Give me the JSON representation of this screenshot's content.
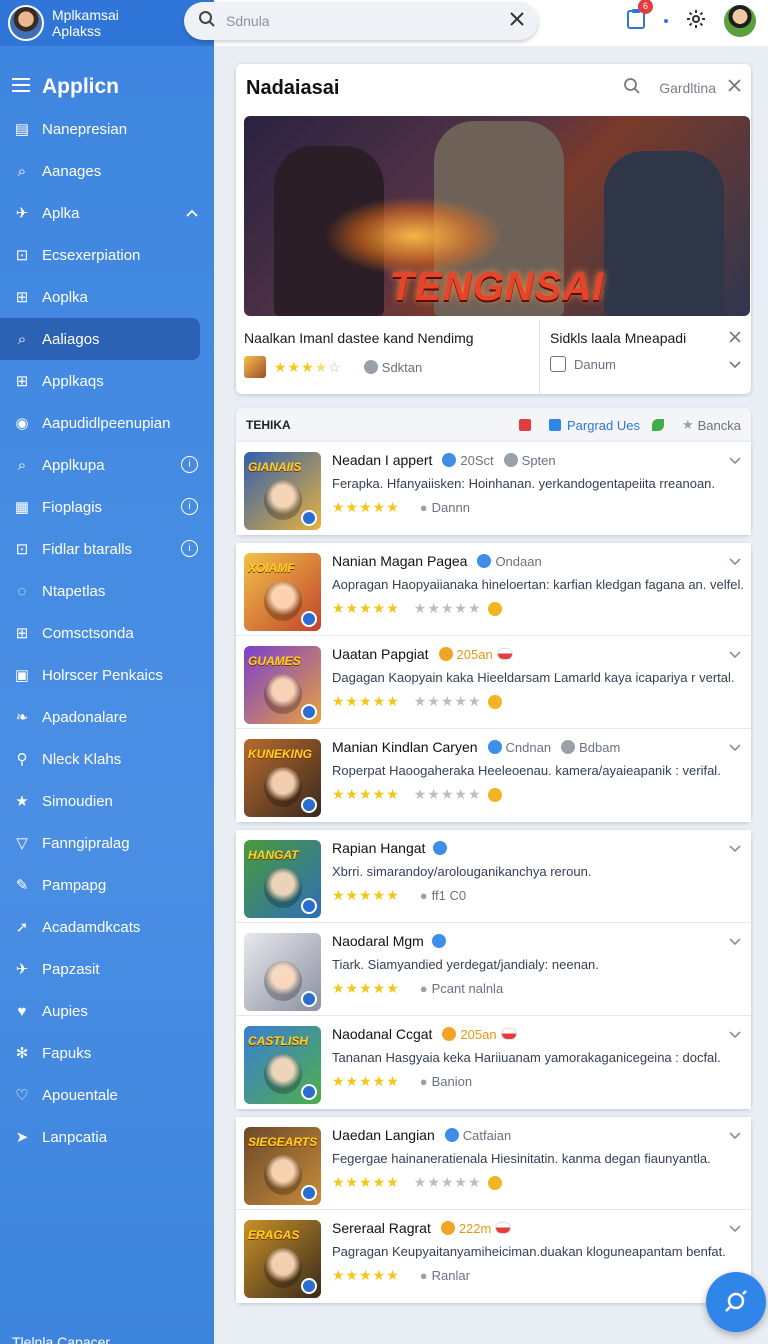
{
  "brand": {
    "line1": "Mplkamsai",
    "line2": "Aplakss"
  },
  "search": {
    "placeholder": "Sdnula"
  },
  "notifications": {
    "badge": "6"
  },
  "sidebar": {
    "header": "Applicn",
    "items": [
      {
        "label": "Nanepresian",
        "icon": "document-icon"
      },
      {
        "label": "Aanages",
        "icon": "search-icon"
      },
      {
        "label": "Aplka",
        "icon": "pin-icon",
        "right": "chevron-up"
      },
      {
        "label": "Ecsexerpiation",
        "icon": "image-icon"
      },
      {
        "label": "Aoplka",
        "icon": "grid-icon"
      },
      {
        "label": "Aaliagos",
        "icon": "search-icon",
        "active": true
      },
      {
        "label": "Applkaqs",
        "icon": "grid-icon"
      },
      {
        "label": "Aapudidlpeenupian",
        "icon": "compass-icon"
      },
      {
        "label": "Applkupa",
        "icon": "search-icon",
        "right": "info"
      },
      {
        "label": "Fioplagis",
        "icon": "list-icon",
        "right": "info"
      },
      {
        "label": "Fidlar btaralls",
        "icon": "image-icon",
        "right": "info"
      },
      {
        "label": "Ntapetlas",
        "icon": "chat-icon"
      },
      {
        "label": "Comsctsonda",
        "icon": "grid-icon"
      },
      {
        "label": "Holrscer Penkaics",
        "icon": "frame-icon"
      },
      {
        "label": "Apadonalare",
        "icon": "bird-icon"
      },
      {
        "label": "Nleck Klahs",
        "icon": "runner-icon"
      },
      {
        "label": "Simoudien",
        "icon": "star-icon"
      },
      {
        "label": "Fanngipralag",
        "icon": "filter-icon"
      },
      {
        "label": "Pampapg",
        "icon": "pencil-icon"
      },
      {
        "label": "Acadamdkcats",
        "icon": "arrow-icon"
      },
      {
        "label": "Papzasit",
        "icon": "pin-icon"
      },
      {
        "label": "Aupies",
        "icon": "heart-icon"
      },
      {
        "label": "Fapuks",
        "icon": "gear-icon"
      },
      {
        "label": "Apouentale",
        "icon": "heart-outline-icon"
      },
      {
        "label": "Lanpcatia",
        "icon": "send-icon"
      }
    ],
    "footer": "Tlelnla Capacer"
  },
  "hero": {
    "title": "Nadaiasai",
    "search_label": "Gardltina",
    "banner_title": "TENGNSAI",
    "left_title": "Naalkan Imanl dastee kand Nendimg",
    "left_sub": "Sdktan",
    "left_rating": 3.5,
    "right_title": "Sidkls laala Mneapadi",
    "right_sub": "Danum"
  },
  "list": {
    "header": "TEHIKA",
    "tag1": "Pargrad Ues",
    "tag2": "Bancka",
    "groups": [
      [
        {
          "title": "Neadan I appert",
          "meta1": "20Sct",
          "meta2": "Spten",
          "desc": "Ferapka. Hfanyaiisken: Hoinhanan. yerkandogentapeiita rreanoan.",
          "stars": "★★★★★",
          "tail": "Dannn",
          "thumb_word": "GIANAIIS",
          "thumb_colors": [
            "#2f5fae",
            "#e9b23c"
          ]
        }
      ],
      [
        {
          "title": "Nanian Magan Pagea",
          "meta1": "Ondaan",
          "desc": "Aopragan Haopyaiianaka hineloertan: karfian kledgan fagana an. velfel.",
          "stars": "★★★★★",
          "stars2": "★★★★★",
          "thumb_word": "XOIAMF",
          "thumb_colors": [
            "#f2c14a",
            "#c0432a"
          ]
        },
        {
          "title": "Uaatan Papgiat",
          "meta1": "205an",
          "desc": "Dagagan Kaopyain kaka Hieeldarsam Lamarld kaya icapariya r vertal.",
          "stars": "★★★★★",
          "stars2": "★★★★★",
          "thumb_word": "GUAMES",
          "thumb_colors": [
            "#7a3fd1",
            "#e8a13a"
          ]
        },
        {
          "title": "Manian Kindlan Caryen",
          "meta1": "Cndnan",
          "meta2": "Bdbam",
          "desc": "Roperpat Haoogaheraka Heeleoenau. kamera/ayaieapanik : verifal.",
          "stars": "★★★★★",
          "stars2": "★★★★★",
          "thumb_word": "KUNEKING",
          "thumb_colors": [
            "#b76a2e",
            "#3a2a1e"
          ]
        }
      ],
      [
        {
          "title": "Rapian Hangat",
          "desc": "Xbrri. simarandoy/arolouganikanchya reroun.",
          "stars": "★★★★★",
          "tail": "ff1 C0",
          "thumb_word": "HANGAT",
          "thumb_colors": [
            "#4a9a3a",
            "#2e6fb8"
          ]
        },
        {
          "title": "Naodaral Mgm",
          "desc": "Tiark. Siamyandied yerdegat/jandialy: neenan.",
          "stars": "★★★★★",
          "tail": "Pcant nalnla",
          "thumb_word": "",
          "thumb_colors": [
            "#e8e9ec",
            "#8a90a0"
          ]
        },
        {
          "title": "Naodanal Ccgat",
          "meta1": "205an",
          "desc": "Tananan Hasgyaia keka Hariiuanam yamorakaganicegeina : docfal.",
          "stars": "★★★★★",
          "tail": "Banion",
          "thumb_word": "CASTLISH",
          "thumb_colors": [
            "#3a7ed6",
            "#4fae4a"
          ]
        }
      ],
      [
        {
          "title": "Uaedan Langian",
          "meta1": "Catfaian",
          "desc": "Fegergae hainaneratienala Hiesinitatin. kanma degan fiaunyantla.",
          "stars": "★★★★★",
          "stars2": "★★★★★",
          "thumb_word": "SIEGEARTS",
          "thumb_colors": [
            "#6b4a2a",
            "#c88a3a"
          ]
        },
        {
          "title": "Sereraal Ragrat",
          "meta1": "222m",
          "desc": "Pagragan Keupyaitanyamiheiciman.duakan kloguneapantam benfat.",
          "stars": "★★★★★",
          "tail": "Ranlar",
          "thumb_word": "ERAGAS",
          "thumb_colors": [
            "#c8902a",
            "#3a2a1a"
          ]
        }
      ]
    ]
  }
}
